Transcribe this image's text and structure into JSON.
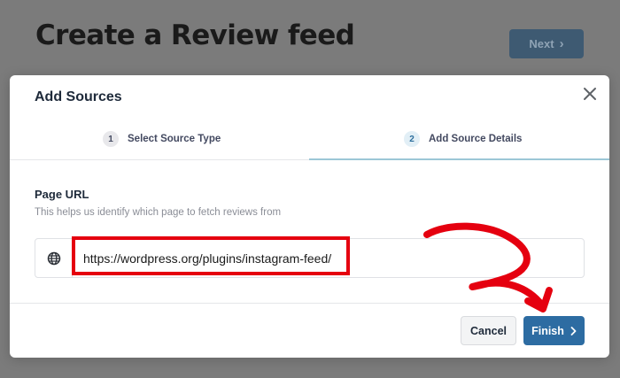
{
  "background": {
    "page_title": "Create a Review feed",
    "next_label": "Next"
  },
  "modal": {
    "title": "Add Sources",
    "steps": [
      {
        "number": "1",
        "label": "Select Source Type"
      },
      {
        "number": "2",
        "label": "Add Source Details"
      }
    ],
    "field": {
      "label": "Page URL",
      "help": "This helps us identify which page to fetch reviews from",
      "value": "https://wordpress.org/plugins/instagram-feed/"
    },
    "footer": {
      "cancel_label": "Cancel",
      "finish_label": "Finish"
    }
  },
  "icons": {
    "close": "close-icon",
    "globe": "globe-icon",
    "chevron": "chevron-right-icon"
  },
  "colors": {
    "primary": "#2d6ca2",
    "highlight": "#e5000f",
    "overlay": "#7b7b7b"
  }
}
